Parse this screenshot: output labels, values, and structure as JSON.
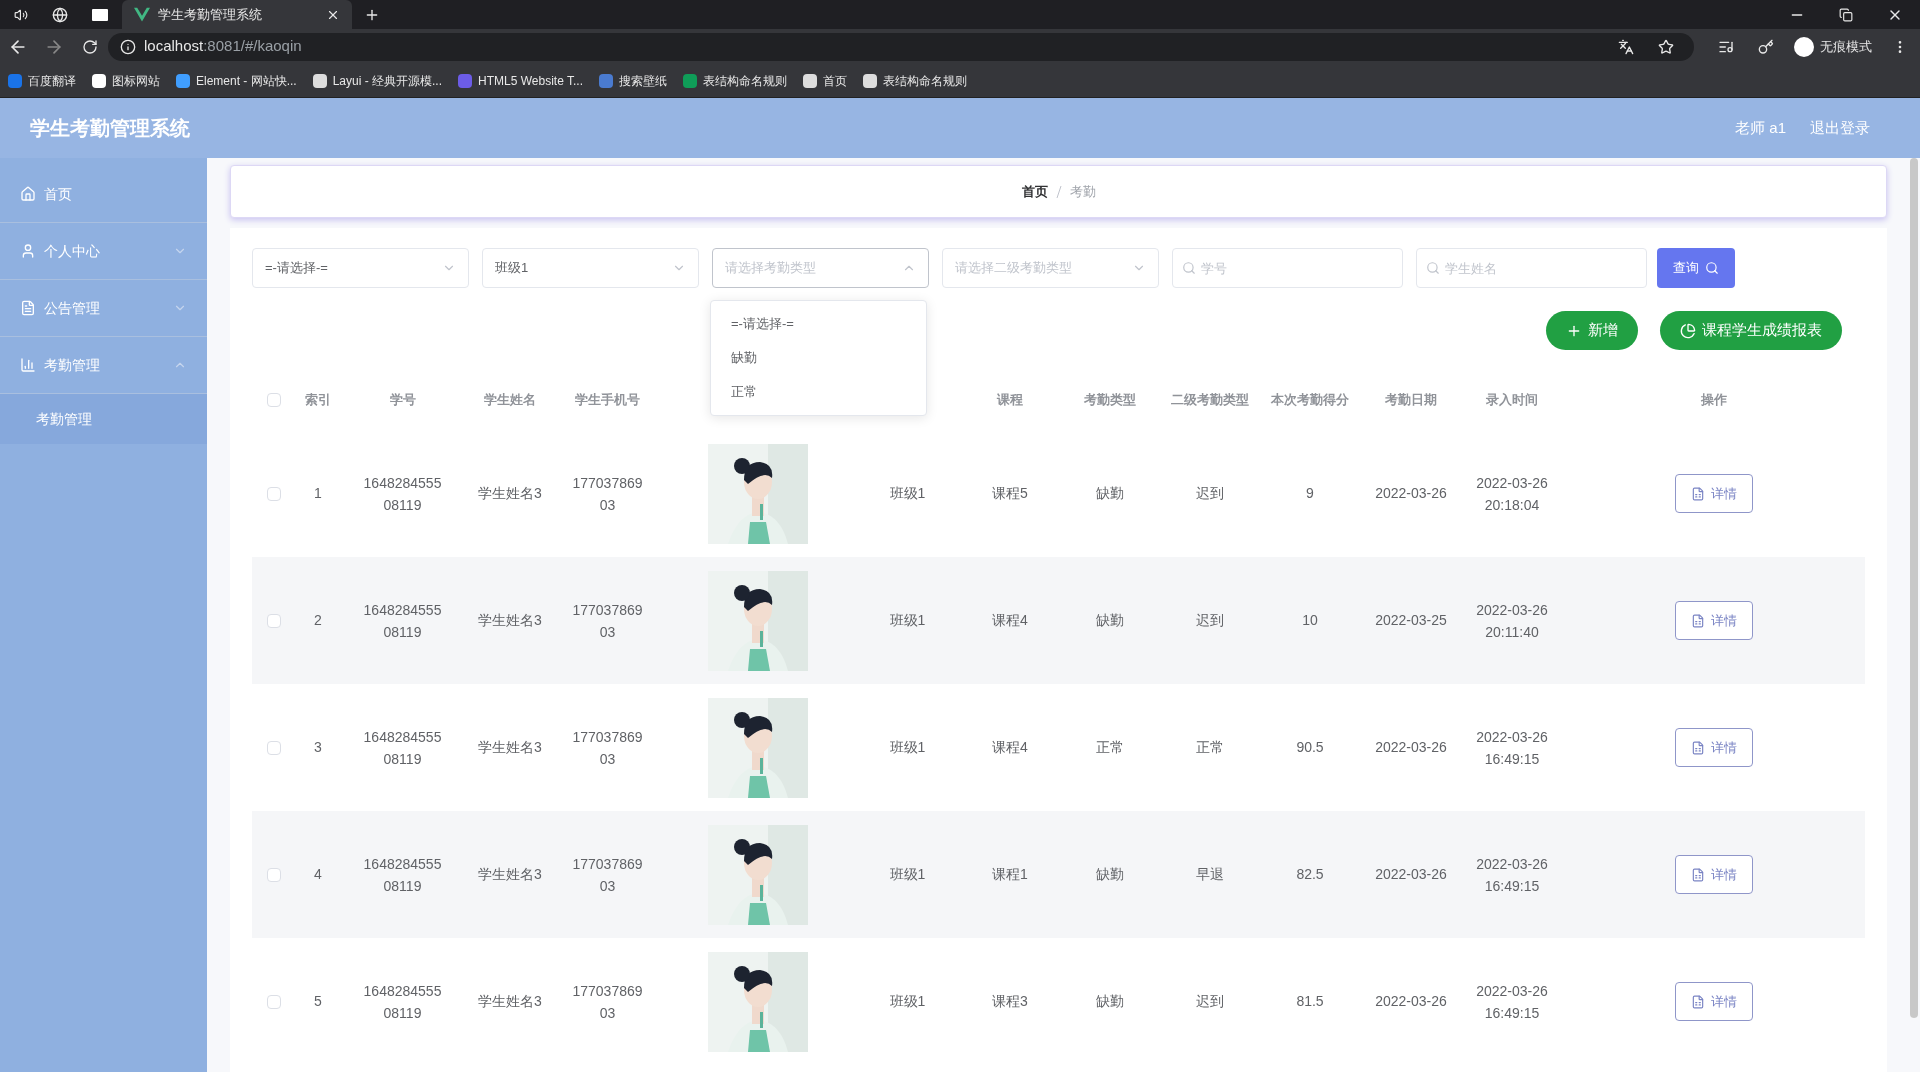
{
  "browser": {
    "tab_title": "学生考勤管理系统",
    "url_host": "localhost",
    "url_rest": ":8081/#/kaoqin",
    "profile": "无痕模式",
    "bookmarks": [
      {
        "label": "百度翻译",
        "color": "#1a73e8"
      },
      {
        "label": "图标网站",
        "color": "#ffffff"
      },
      {
        "label": "Element - 网站快...",
        "color": "#409eff"
      },
      {
        "label": "Layui - 经典开源模...",
        "color": "#dddddd"
      },
      {
        "label": "HTML5 Website T...",
        "color": "#6c5ce7"
      },
      {
        "label": "搜索壁纸",
        "color": "#4a7bd0"
      },
      {
        "label": "表结构命名规则",
        "color": "#0f9d58"
      },
      {
        "label": "首页",
        "color": "#dddddd"
      },
      {
        "label": "表结构命名规则",
        "color": "#dddddd"
      }
    ]
  },
  "app": {
    "title": "学生考勤管理系统",
    "user": "老师 a1",
    "logout": "退出登录"
  },
  "sidebar": {
    "items": [
      {
        "label": "首页",
        "kind": "link"
      },
      {
        "label": "个人中心",
        "kind": "group",
        "expanded": false
      },
      {
        "label": "公告管理",
        "kind": "group",
        "expanded": false
      },
      {
        "label": "考勤管理",
        "kind": "group",
        "expanded": true,
        "children": [
          {
            "label": "考勤管理",
            "selected": true
          }
        ]
      }
    ]
  },
  "breadcrumb": [
    "首页",
    "考勤"
  ],
  "filters": [
    {
      "kind": "select",
      "value": "=-请选择-=",
      "open": false
    },
    {
      "kind": "select",
      "value": "班级1",
      "open": false
    },
    {
      "kind": "select",
      "placeholder": "请选择考勤类型",
      "open": true
    },
    {
      "kind": "select",
      "placeholder": "请选择二级考勤类型",
      "open": false
    },
    {
      "kind": "search",
      "placeholder": "学号"
    },
    {
      "kind": "search",
      "placeholder": "学生姓名"
    }
  ],
  "query_button": "查询",
  "dropdown_options": [
    {
      "label": "=-请选择-=",
      "selected": false
    },
    {
      "label": "缺勤",
      "selected": false
    },
    {
      "label": "正常",
      "selected": false
    }
  ],
  "actions": [
    {
      "label": "新增"
    },
    {
      "label": "课程学生成绩报表"
    }
  ],
  "table": {
    "all_checked": false,
    "columns": [
      "索引",
      "学号",
      "学生姓名",
      "学生手机号",
      "课程",
      "考勤类型",
      "二级考勤类型",
      "本次考勤得分",
      "考勤日期",
      "录入时间",
      "操作"
    ],
    "rows": [
      {
        "index": "1",
        "student_no": "164828455508119",
        "name": "学生姓名3",
        "phone": "17703786903",
        "class": "班级1",
        "course": "课程5",
        "type": "缺勤",
        "sub_type": "迟到",
        "score": "9",
        "date": "2022-03-26",
        "created": "2022-03-26 20:18:04",
        "action": "详情",
        "checked": false
      },
      {
        "index": "2",
        "student_no": "164828455508119",
        "name": "学生姓名3",
        "phone": "17703786903",
        "class": "班级1",
        "course": "课程4",
        "type": "缺勤",
        "sub_type": "迟到",
        "score": "10",
        "date": "2022-03-25",
        "created": "2022-03-26 20:11:40",
        "action": "详情",
        "checked": false
      },
      {
        "index": "3",
        "student_no": "164828455508119",
        "name": "学生姓名3",
        "phone": "17703786903",
        "class": "班级1",
        "course": "课程4",
        "type": "正常",
        "sub_type": "正常",
        "score": "90.5",
        "date": "2022-03-26",
        "created": "2022-03-26 16:49:15",
        "action": "详情",
        "checked": false
      },
      {
        "index": "4",
        "student_no": "164828455508119",
        "name": "学生姓名3",
        "phone": "17703786903",
        "class": "班级1",
        "course": "课程1",
        "type": "缺勤",
        "sub_type": "早退",
        "score": "82.5",
        "date": "2022-03-26",
        "created": "2022-03-26 16:49:15",
        "action": "详情",
        "checked": false
      },
      {
        "index": "5",
        "student_no": "164828455508119",
        "name": "学生姓名3",
        "phone": "17703786903",
        "class": "班级1",
        "course": "课程3",
        "type": "缺勤",
        "sub_type": "迟到",
        "score": "81.5",
        "date": "2022-03-26",
        "created": "2022-03-26 16:49:15",
        "action": "详情",
        "checked": false
      }
    ]
  }
}
